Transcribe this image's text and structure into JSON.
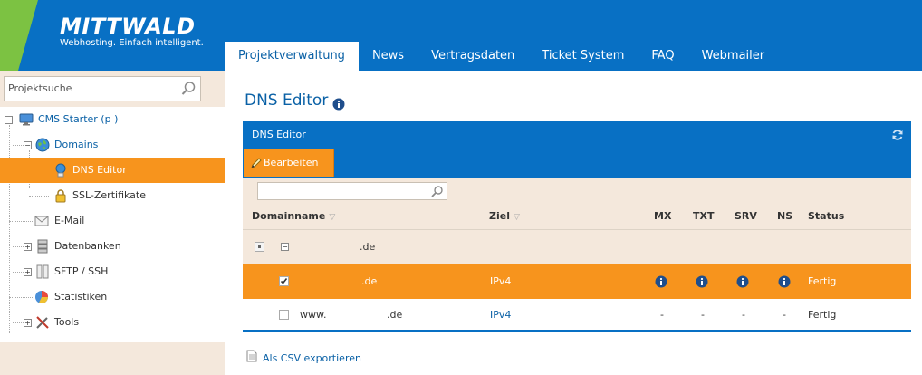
{
  "brand": {
    "name": "MITTWALD",
    "tagline": "Webhosting. Einfach intelligent.",
    "colors": {
      "primary": "#0870c4",
      "accent": "#f7941d",
      "green": "#7cc242",
      "beige": "#f4e8dc"
    }
  },
  "nav": {
    "tabs": [
      {
        "label": "Projektverwaltung",
        "active": true
      },
      {
        "label": "News"
      },
      {
        "label": "Vertragsdaten"
      },
      {
        "label": "Ticket System"
      },
      {
        "label": "FAQ"
      },
      {
        "label": "Webmailer"
      }
    ]
  },
  "sidebar": {
    "search": {
      "value": "Projektsuche",
      "icon": "search-icon"
    },
    "tree": [
      {
        "label": "CMS Starter (p            )",
        "icon": "monitor-icon",
        "expanded": true
      },
      {
        "label": "Domains",
        "icon": "globe-icon",
        "expanded": true
      },
      {
        "label": "DNS Editor",
        "icon": "dns-icon",
        "active": true
      },
      {
        "label": "SSL-Zertifikate",
        "icon": "lock-icon"
      },
      {
        "label": "E-Mail",
        "icon": "envelope-icon"
      },
      {
        "label": "Datenbanken",
        "icon": "database-icon"
      },
      {
        "label": "SFTP / SSH",
        "icon": "server-icon"
      },
      {
        "label": "Statistiken",
        "icon": "pie-chart-icon"
      },
      {
        "label": "Tools",
        "icon": "tools-icon"
      }
    ]
  },
  "main": {
    "page_title": "DNS Editor",
    "panel_title": "DNS Editor",
    "edit_button": "Bearbeiten",
    "filter_placeholder": "",
    "columns": {
      "domainname": "Domainname",
      "ziel": "Ziel",
      "mx": "MX",
      "txt": "TXT",
      "srv": "SRV",
      "ns": "NS",
      "status": "Status"
    },
    "group": {
      "domain": ".de"
    },
    "rows": [
      {
        "domain": ".de",
        "ziel": "IPv4",
        "mx": "info",
        "txt": "info",
        "srv": "info",
        "ns": "info",
        "status": "Fertig",
        "checked": true,
        "selected": true
      },
      {
        "domain_prefix": "www.",
        "domain": ".de",
        "ziel": "IPv4",
        "mx": "-",
        "txt": "-",
        "srv": "-",
        "ns": "-",
        "status": "Fertig",
        "checked": false,
        "selected": false
      }
    ],
    "export_label": "Als CSV exportieren"
  }
}
